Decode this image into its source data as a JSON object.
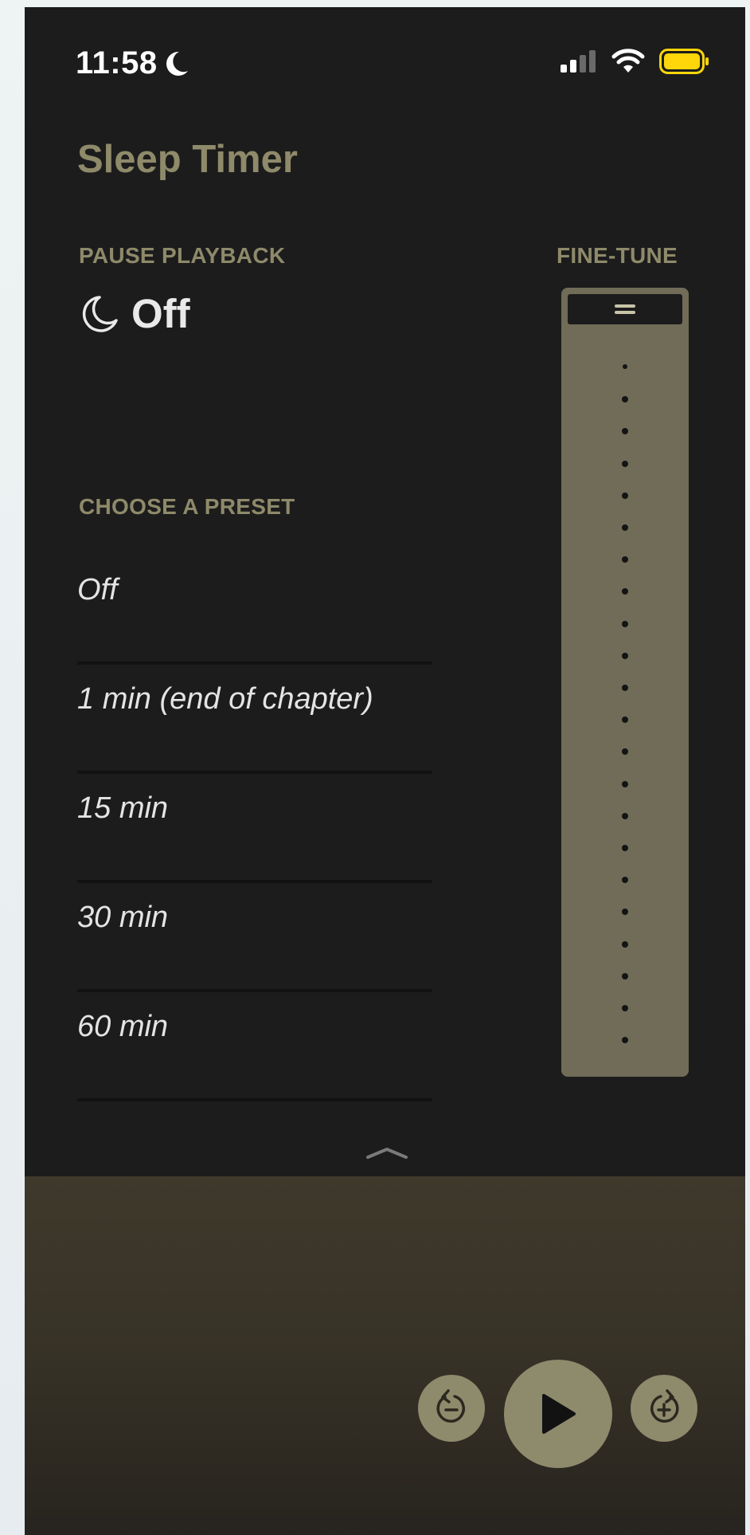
{
  "status_bar": {
    "time": "11:58"
  },
  "title": "Sleep Timer",
  "pause_playback": {
    "label": "PAUSE PLAYBACK",
    "value": "Off"
  },
  "fine_tune": {
    "label": "FINE-TUNE",
    "tick_count": 22
  },
  "presets": {
    "label": "CHOOSE A PRESET",
    "items": [
      "Off",
      "1 min (end of chapter)",
      "15 min",
      "30 min",
      "60 min"
    ]
  },
  "icons": {
    "status_moon": "moon-icon",
    "signal": "cellular-signal-icon",
    "wifi": "wifi-icon",
    "battery": "battery-icon",
    "timer_moon": "moon-icon",
    "drawer": "chevron-up-icon",
    "skip_back": "skip-back-icon",
    "play": "play-icon",
    "skip_forward": "skip-forward-icon"
  },
  "colors": {
    "accent": "#8e8a6a",
    "background": "#1c1c1c",
    "slider": "#706c58",
    "battery": "#ffd60a"
  }
}
